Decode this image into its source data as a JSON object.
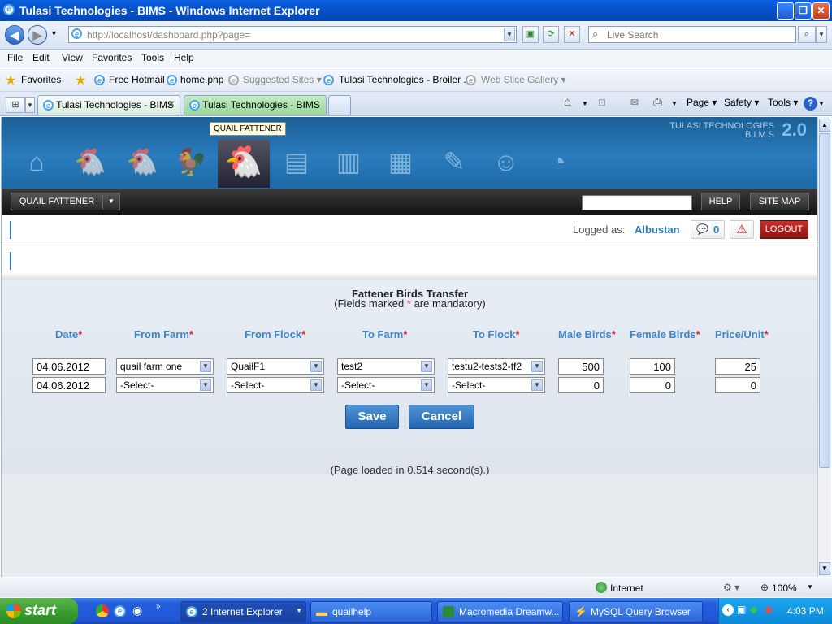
{
  "window": {
    "title": "Tulasi Technologies - BIMS - Windows Internet Explorer"
  },
  "browser": {
    "address": "http://localhost/dashboard.php?page=",
    "search_placeholder": "Live Search",
    "menus": [
      "File",
      "Edit",
      "View",
      "Favorites",
      "Tools",
      "Help"
    ],
    "favorites_label": "Favorites",
    "favorites": [
      {
        "label": "Free Hotmail",
        "gray": false
      },
      {
        "label": "home.php",
        "gray": false
      },
      {
        "label": "Suggested Sites ▾",
        "gray": true
      },
      {
        "label": "Tulasi Technologies - Broiler ...",
        "gray": false
      },
      {
        "label": "Web Slice Gallery ▾",
        "gray": true
      }
    ],
    "tabs": [
      "Tulasi Technologies - BIMS",
      "Tulasi Technologies - BIMS"
    ],
    "commands": {
      "page": "Page ▾",
      "safety": "Safety ▾",
      "tools": "Tools ▾"
    }
  },
  "app": {
    "tooltip": "QUAIL FATTENER",
    "brand_line1": "TULASI TECHNOLOGIES",
    "brand_line2": "B.I.M.S",
    "brand_version": "2.0",
    "module_menu": "QUAIL FATTENER",
    "help": "HELP",
    "sitemap": "SITE MAP",
    "logged_as_label": "Logged as:",
    "user": "Albustan",
    "messages_count": "0",
    "logout": "LOGOUT"
  },
  "form": {
    "title": "Fattener Birds Transfer",
    "subtitle_pre": "(Fields marked",
    "subtitle_star": "*",
    "subtitle_post": "are mandatory)",
    "headers": [
      "Date",
      "From Farm",
      "From Flock",
      "To Farm",
      "To Flock",
      "Male Birds",
      "Female Birds",
      "Price/Unit"
    ],
    "rows": [
      {
        "date": "04.06.2012",
        "from_farm": "quail farm one",
        "from_flock": "QuailF1",
        "to_farm": "test2",
        "to_flock": "testu2-tests2-tf2",
        "male": "500",
        "female": "100",
        "price": "25"
      },
      {
        "date": "04.06.2012",
        "from_farm": "-Select-",
        "from_flock": "-Select-",
        "to_farm": "-Select-",
        "to_flock": "-Select-",
        "male": "0",
        "female": "0",
        "price": "0"
      }
    ],
    "save": "Save",
    "cancel": "Cancel",
    "load_time": "(Page loaded in 0.514 second(s).)"
  },
  "statusbar": {
    "zone": "Internet",
    "zoom": "100%"
  },
  "taskbar": {
    "start": "start",
    "tasks": [
      "2 Internet Explorer",
      "quailhelp",
      "Macromedia Dreamw...",
      "MySQL Query Browser"
    ],
    "clock": "4:03 PM"
  }
}
